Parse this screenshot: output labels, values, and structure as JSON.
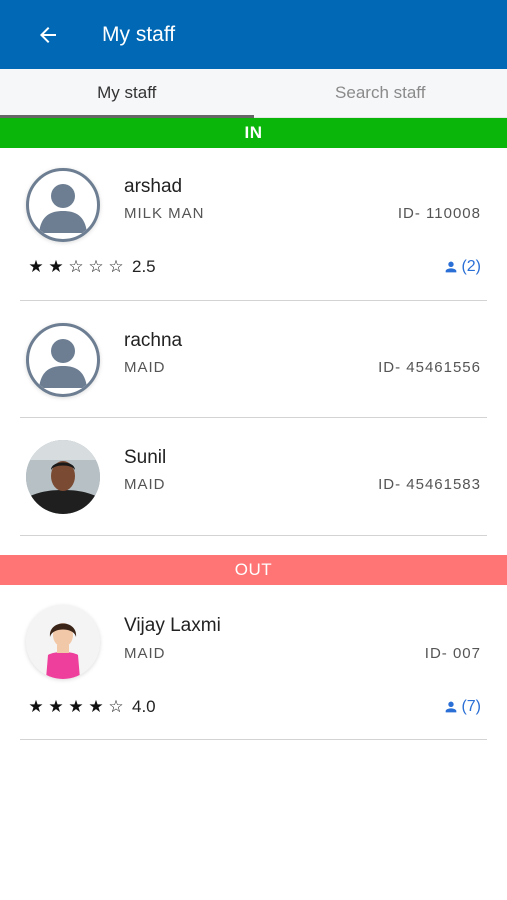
{
  "appbar": {
    "title": "My staff",
    "back_icon": "arrow-left-icon"
  },
  "tabs": [
    {
      "label": "My staff",
      "active": true
    },
    {
      "label": "Search staff",
      "active": false
    }
  ],
  "sections": {
    "in_label": "IN",
    "out_label": "OUT"
  },
  "colors": {
    "appbar": "#0068b4",
    "in_bar": "#0bb60b",
    "out_bar": "#ff7474",
    "link": "#2a6fd6"
  },
  "staff_in": [
    {
      "name": "arshad",
      "role": "MILK MAN",
      "id": "ID- 110008",
      "avatar": "default-person-icon",
      "rating": "2.5",
      "rating_value": 2.5,
      "visits": "(2)"
    },
    {
      "name": "rachna",
      "role": "MAID",
      "id": "ID- 45461556",
      "avatar": "default-person-icon"
    },
    {
      "name": "Sunil",
      "role": "MAID",
      "id": "ID- 45461583",
      "avatar": "photo"
    }
  ],
  "staff_out": [
    {
      "name": "Vijay Laxmi",
      "role": "MAID",
      "id": "ID- 007",
      "avatar": "photo",
      "rating": "4.0",
      "rating_value": 4.0,
      "visits": "(7)"
    }
  ]
}
